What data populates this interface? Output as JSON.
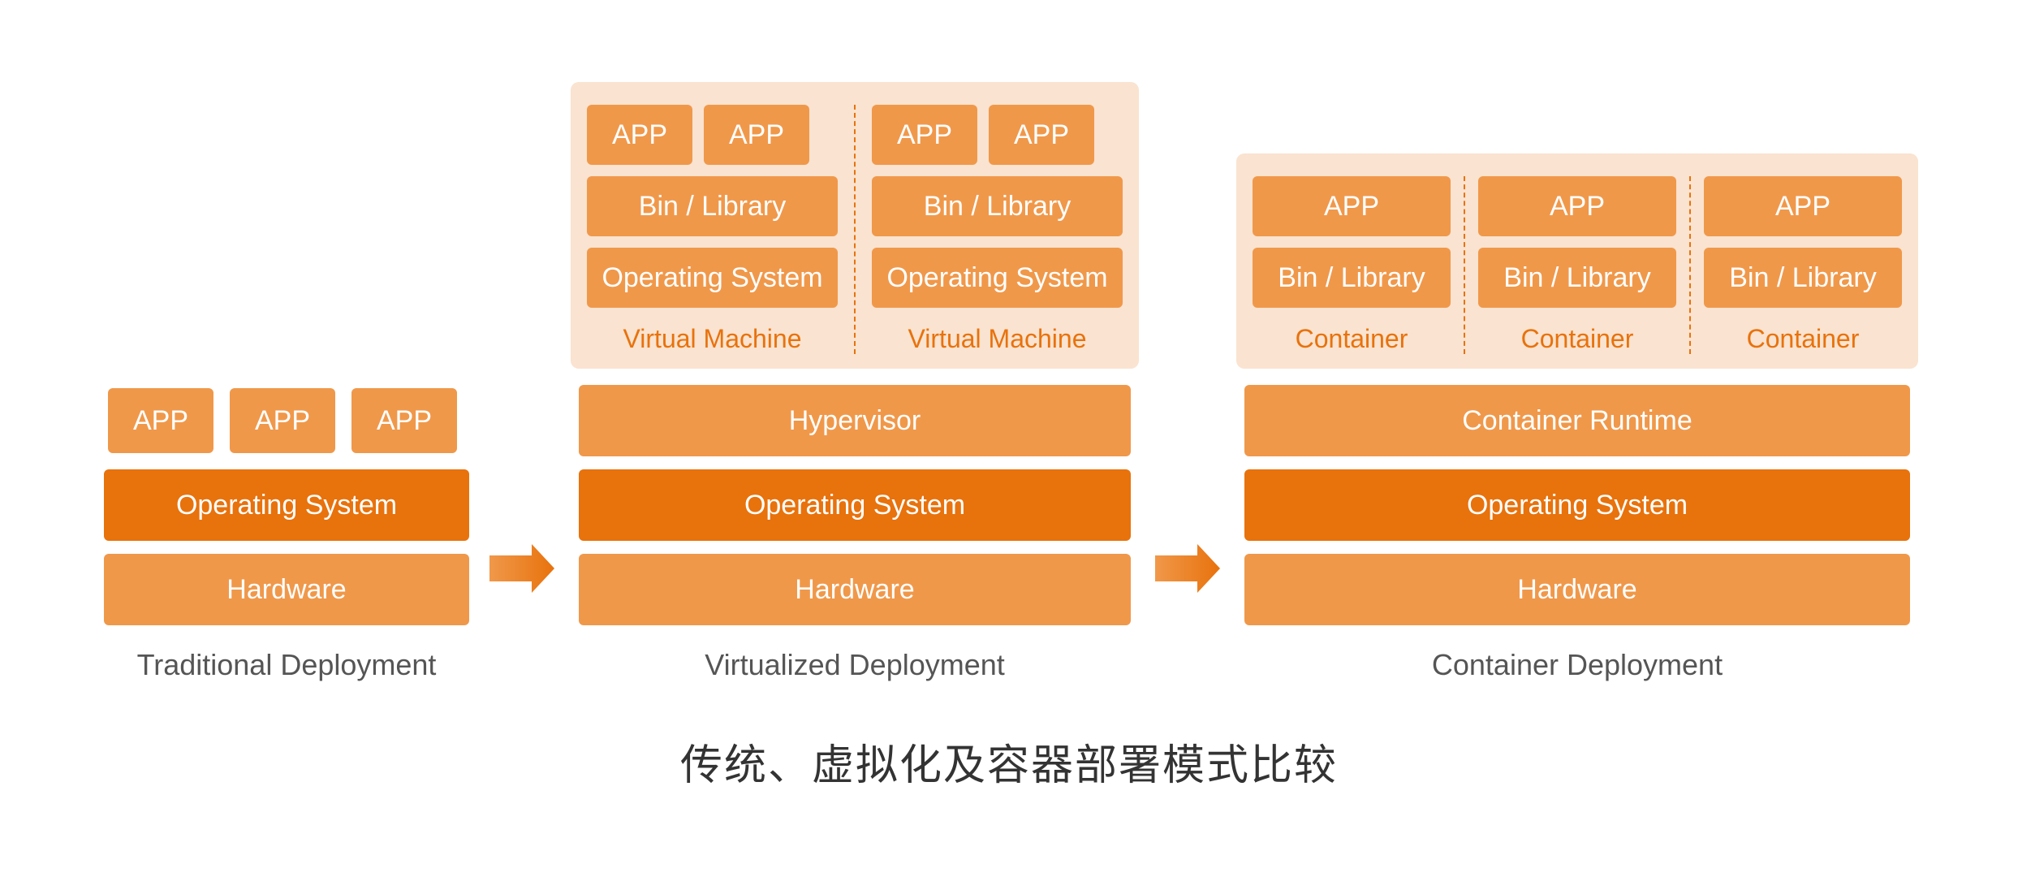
{
  "colors": {
    "orange_dark": "#E8720C",
    "orange_mid": "#F0984A",
    "orange_light": "#FAE3D0",
    "orange_lighter": "#F5B97A",
    "label_color": "#E8720C",
    "col_label_color": "#666"
  },
  "traditional": {
    "apps": [
      "APP",
      "APP",
      "APP"
    ],
    "os": "Operating System",
    "hw": "Hardware",
    "label": "Traditional Deployment"
  },
  "virtualized": {
    "vm1": {
      "apps": [
        "APP",
        "APP"
      ],
      "bin": "Bin / Library",
      "os": "Operating System",
      "label": "Virtual Machine"
    },
    "vm2": {
      "apps": [
        "APP",
        "APP"
      ],
      "bin": "Bin / Library",
      "os": "Operating System",
      "label": "Virtual Machine"
    },
    "hypervisor": "Hypervisor",
    "os": "Operating System",
    "hw": "Hardware",
    "label": "Virtualized Deployment"
  },
  "container": {
    "c1": {
      "app": "APP",
      "bin": "Bin / Library",
      "label": "Container"
    },
    "c2": {
      "app": "APP",
      "bin": "Bin / Library",
      "label": "Container"
    },
    "c3": {
      "app": "APP",
      "bin": "Bin / Library",
      "label": "Container"
    },
    "runtime": "Container Runtime",
    "os": "Operating System",
    "hw": "Hardware",
    "label": "Container Deployment"
  },
  "footer": "传统、虚拟化及容器部署模式比较"
}
